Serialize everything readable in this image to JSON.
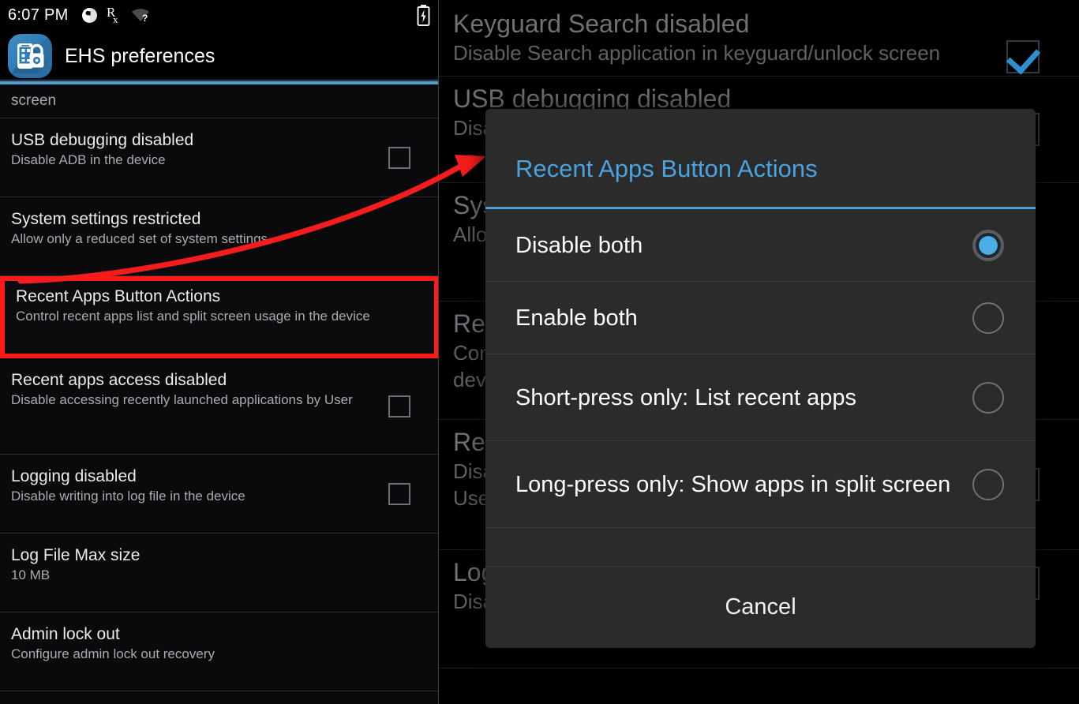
{
  "status_bar": {
    "clock": "6:07 PM",
    "icons": [
      "do-not-disturb-icon",
      "prescription-rx-icon",
      "wifi-question-icon",
      "battery-charging-icon"
    ]
  },
  "app_bar": {
    "icon": "ehs-app-icon",
    "title": "EHS preferences"
  },
  "colors": {
    "accent_blue": "#4d9fd4",
    "dialog_title_blue": "#4aa3df",
    "highlight_red": "#ff1a1a",
    "panel_bg": "#0a0a0c",
    "dialog_bg": "#2b2b2b"
  },
  "left_list": {
    "partial_top_row": {
      "summary": "screen"
    },
    "rows": [
      {
        "title": "USB debugging disabled",
        "summary": "Disable ADB in the device",
        "checkbox": "unchecked"
      },
      {
        "title": "System settings restricted",
        "summary": "Allow only a reduced set of system settings",
        "checkbox": "none"
      },
      {
        "title": "Recent Apps Button Actions",
        "summary": "Control recent apps list and split screen usage in the device",
        "checkbox": "none",
        "highlighted": true
      },
      {
        "title": "Recent apps access disabled",
        "summary": "Disable accessing recently launched applications by User",
        "checkbox": "unchecked"
      },
      {
        "title": "Logging disabled",
        "summary": "Disable writing into log file in the device",
        "checkbox": "unchecked"
      },
      {
        "title": "Log File Max size",
        "summary": "10 MB",
        "checkbox": "none"
      },
      {
        "title": "Admin lock out",
        "summary": "Configure admin lock out recovery",
        "checkbox": "none"
      }
    ]
  },
  "background_list": {
    "rows": [
      {
        "title": "Keyguard Search disabled",
        "summary": "Disable Search application in keyguard/unlock screen",
        "checkbox": "checked"
      },
      {
        "title": "USB debugging disabled",
        "summary": "Disable ADB in the device",
        "checkbox": "unchecked"
      },
      {
        "title": "System settings restricted",
        "summary": "Allow only a reduced set of system settings",
        "checkbox": "none"
      },
      {
        "title": "Recent Apps Button Actions",
        "summary": "Control recent apps list and split screen usage in the device",
        "checkbox": "none"
      },
      {
        "title": "Recent apps access disabled",
        "summary": "Disable accessing recently launched applications by User",
        "checkbox": "unchecked"
      },
      {
        "title": "Logging disabled",
        "summary": "Disable writing into log file in the device",
        "checkbox": "unchecked"
      }
    ]
  },
  "dialog": {
    "title": "Recent Apps Button Actions",
    "options": [
      {
        "label": "Disable both",
        "selected": true
      },
      {
        "label": "Enable both",
        "selected": false
      },
      {
        "label": "Short-press only: List recent apps",
        "selected": false
      },
      {
        "label": "Long-press only: Show apps in split screen",
        "selected": false
      }
    ],
    "cancel_label": "Cancel"
  },
  "annotation": {
    "arrow": "red-curved-arrow",
    "highlight_box": "red-rectangle-around-recent-apps-button-actions"
  }
}
